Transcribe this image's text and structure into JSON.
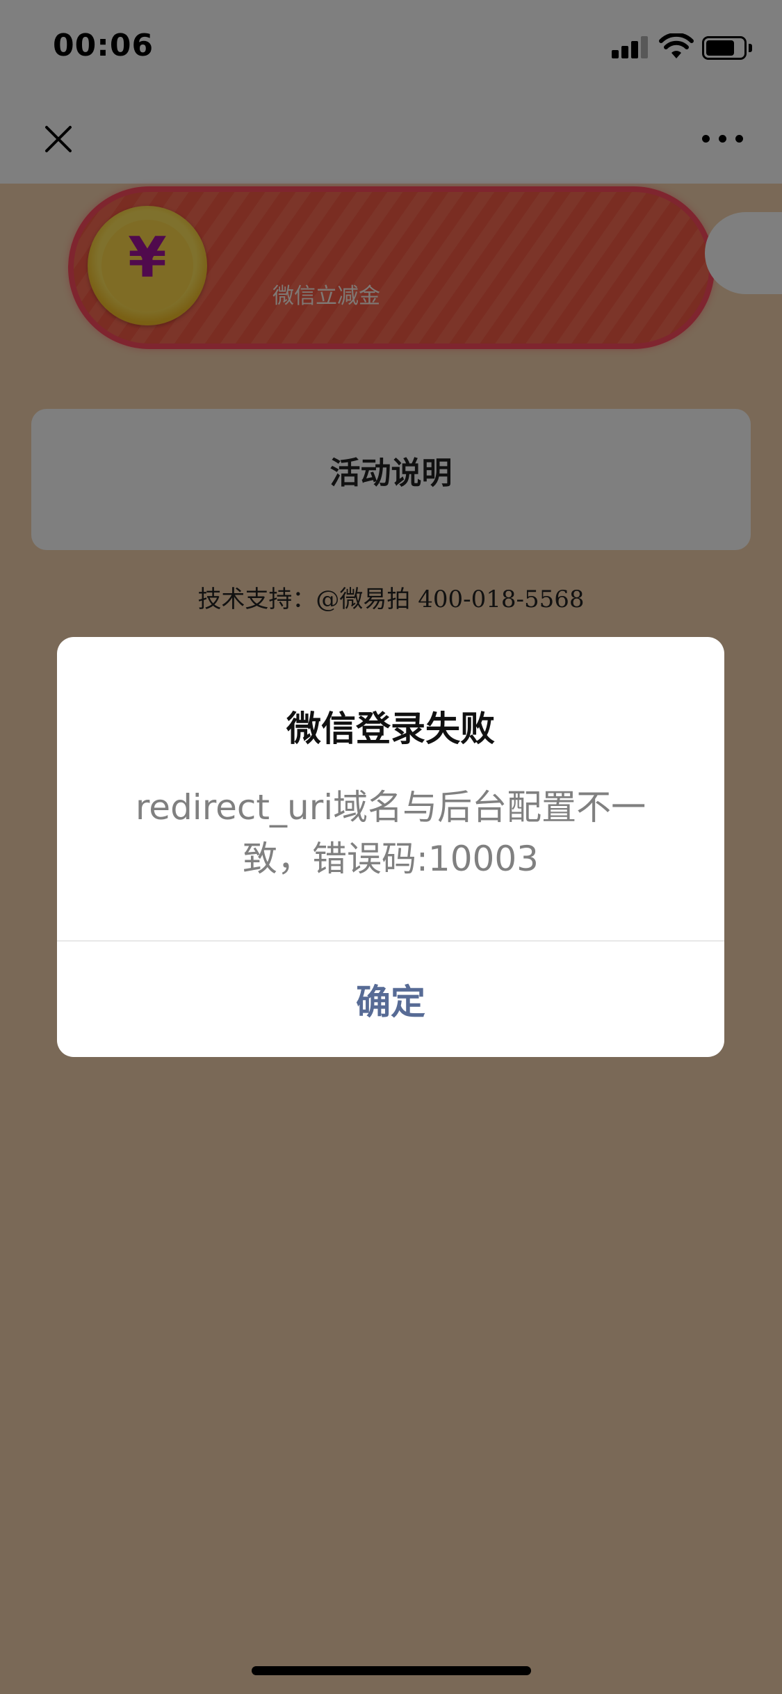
{
  "status_bar": {
    "time": "00:06"
  },
  "nav": {
    "close_icon": "close-icon",
    "more_icon": "more-dots-icon"
  },
  "coupon": {
    "currency_symbol": "¥",
    "label": "微信立减金"
  },
  "activity": {
    "title": "活动说明"
  },
  "support": {
    "text": "技术支持：@微易拍 400-018-5568"
  },
  "dialog": {
    "title": "微信登录失败",
    "message": "redirect_uri域名与后台配置不一致，错误码:10003",
    "confirm_label": "确定"
  },
  "colors": {
    "page_bg": "#f5d2ae",
    "coupon_red": "#f55a45",
    "coin_gold": "#ffd84a",
    "dialog_button": "#576b95"
  }
}
